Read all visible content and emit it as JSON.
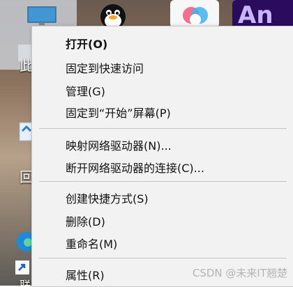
{
  "desktop": {
    "side_labels": [
      "此",
      "回",
      "联想"
    ],
    "tile_an_text": "An"
  },
  "context_menu": {
    "items": [
      {
        "label": "打开(O)",
        "bold": true
      },
      {
        "label": "固定到快速访问"
      },
      {
        "label": "管理(G)"
      },
      {
        "label": "固定到“开始”屏幕(P)"
      },
      {
        "label": "映射网络驱动器(N)..."
      },
      {
        "label": "断开网络驱动器的连接(C)..."
      },
      {
        "label": "创建快捷方式(S)"
      },
      {
        "label": "删除(D)"
      },
      {
        "label": "重命名(M)"
      },
      {
        "label": "属性(R)"
      }
    ]
  },
  "watermark": "CSDN @未来IT翘楚",
  "colors": {
    "menu_bg": "#f2f2f2",
    "separator": "#c4c4c4",
    "text": "#111111"
  }
}
